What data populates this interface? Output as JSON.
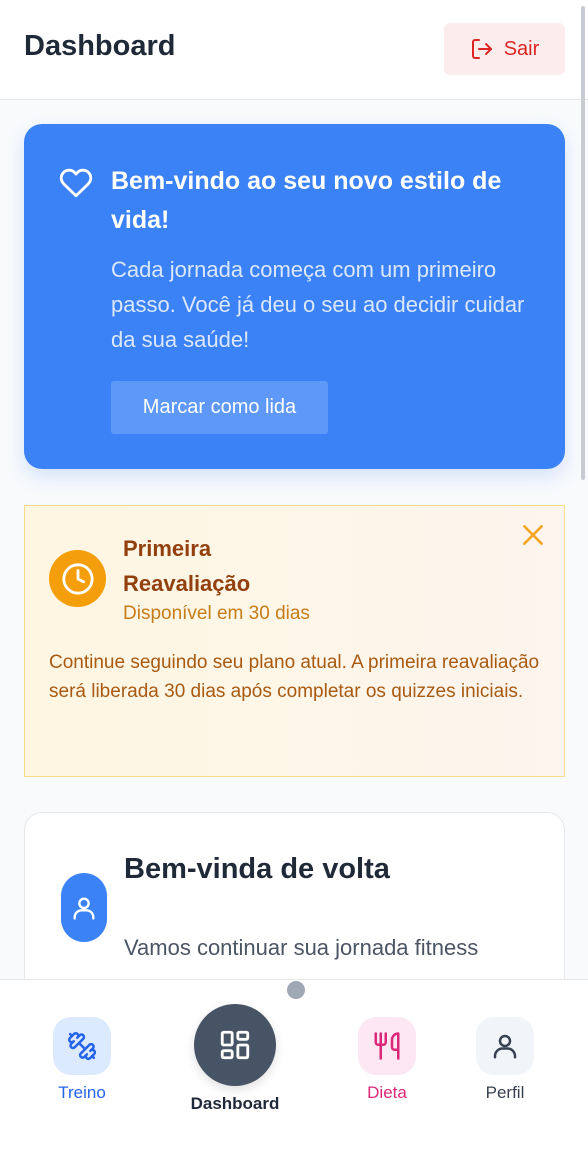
{
  "header": {
    "title": "Dashboard",
    "logout_label": "Sair",
    "logout_icon": "logout-icon"
  },
  "welcome": {
    "icon": "heart-icon",
    "title": "Bem-vindo ao seu novo estilo de vida!",
    "text": "Cada jornada começa com um primeiro passo. Você já deu o seu ao decidir cuidar da sua saúde!",
    "button_label": "Marcar como lida"
  },
  "reassessment": {
    "icon": "clock-icon",
    "title": "Primeira Reavaliação",
    "subtitle": "Disponível em 30 dias",
    "text": "Continue seguindo seu plano atual. A primeira reavaliação será liberada 30 dias após completar os quizzes iniciais.",
    "close_icon": "close-icon"
  },
  "welcome_back": {
    "icon": "user-icon",
    "title": "Bem-vinda de volta",
    "subtitle": "Vamos continuar sua jornada fitness"
  },
  "bottom_nav": {
    "items": [
      {
        "label": "Treino",
        "icon": "dumbbell-icon",
        "color": "#2563eb"
      },
      {
        "label": "Dashboard",
        "icon": "grid-icon",
        "color": "#475466",
        "active": true
      },
      {
        "label": "Dieta",
        "icon": "utensils-icon",
        "color": "#db2777"
      },
      {
        "label": "Perfil",
        "icon": "user-icon",
        "color": "#374151"
      }
    ]
  },
  "colors": {
    "primary": "#3b82f6",
    "danger": "#dc2626",
    "warning": "#f59e0b",
    "warning_text": "#92400e"
  }
}
